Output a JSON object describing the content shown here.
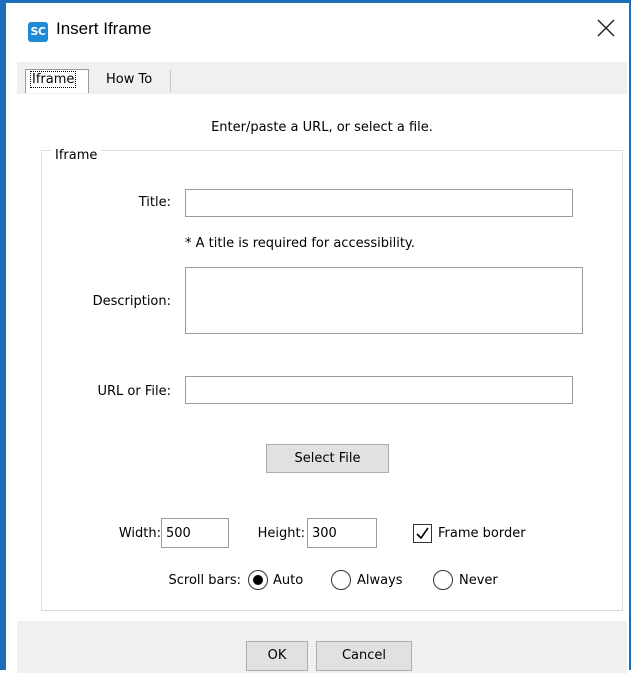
{
  "window": {
    "app_icon_text": "SC",
    "title": "Insert Iframe"
  },
  "tabs": [
    {
      "label": "Iframe",
      "active": true
    },
    {
      "label": "How To",
      "active": false
    }
  ],
  "instruction": "Enter/paste a URL, or select a file.",
  "group": {
    "legend": "Iframe",
    "title_label": "Title:",
    "title_value": "",
    "title_note": "* A title is required for accessibility.",
    "description_label": "Description:",
    "description_value": "",
    "url_label": "URL or File:",
    "url_value": "",
    "select_file_label": "Select File",
    "width_label": "Width:",
    "width_value": "500",
    "height_label": "Height:",
    "height_value": "300",
    "frame_border_label": "Frame border",
    "frame_border_checked": true,
    "scrollbars_label": "Scroll bars:",
    "scroll_options": [
      {
        "label": "Auto",
        "selected": true
      },
      {
        "label": "Always",
        "selected": false
      },
      {
        "label": "Never",
        "selected": false
      }
    ]
  },
  "footer": {
    "ok_label": "OK",
    "cancel_label": "Cancel"
  },
  "colors": {
    "accent_border": "#1c6fb6",
    "app_icon_bg": "#1e8ad6"
  }
}
